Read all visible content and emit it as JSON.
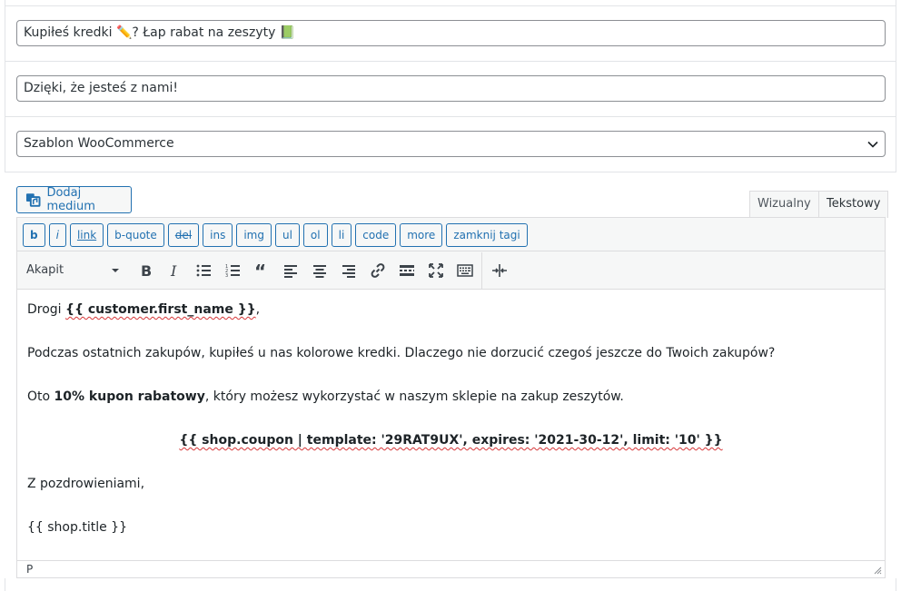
{
  "subject": {
    "value": "Kupiłeś kredki ✏️? Łap rabat na zeszyty 📗"
  },
  "heading": {
    "value": "Dzięki, że jesteś z nami!"
  },
  "template_select": {
    "value": "Szablon WooCommerce"
  },
  "media_button": {
    "label": "Dodaj medium"
  },
  "tabs": {
    "visual": "Wizualny",
    "text": "Tekstowy"
  },
  "quicktags": [
    "b",
    "i",
    "link",
    "b-quote",
    "del",
    "ins",
    "img",
    "ul",
    "ol",
    "li",
    "code",
    "more",
    "zamknij tagi"
  ],
  "format_select": {
    "value": "Akapit"
  },
  "content": {
    "p1_prefix": "Drogi ",
    "p1_var": "{{ customer.first_name }}",
    "p1_suffix": ",",
    "p2": "Podczas ostatnich zakupów, kupiłeś u nas kolorowe kredki. Dlaczego nie dorzucić czegoś jeszcze do Twoich zakupów?",
    "p3_prefix": "Oto ",
    "p3_bold": "10% kupon rabatowy",
    "p3_suffix": ", który możesz wykorzystać w naszym sklepie na zakup zeszytów.",
    "coupon": "{{ shop.coupon | template: '29RAT9UX', expires: '2021-30-12', limit: '10' }}",
    "closing": "Z pozdrowieniami,",
    "signature": "{{ shop.title }}"
  },
  "status_bar": {
    "path": "P"
  }
}
